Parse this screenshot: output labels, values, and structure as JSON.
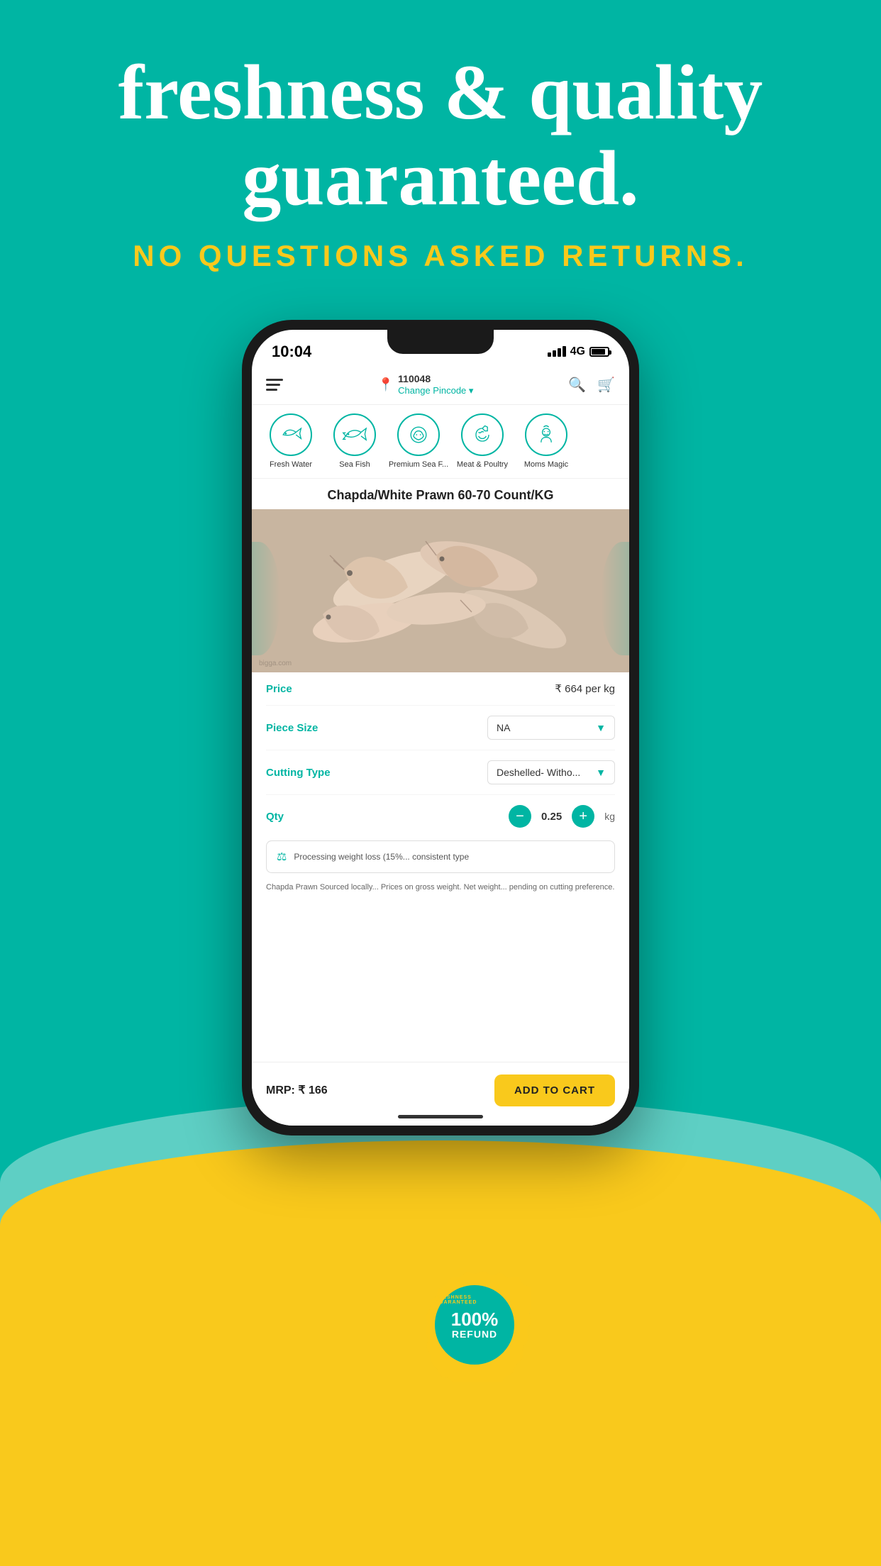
{
  "background": {
    "main_color": "#00B5A3",
    "wave_teal": "#5ECFC4",
    "wave_yellow": "#F9C91C"
  },
  "header": {
    "headline": "freshness  & quality guaranteed.",
    "subheadline": "NO QUESTIONS ASKED RETURNS."
  },
  "phone": {
    "status": {
      "time": "10:04",
      "network": "4G"
    },
    "app_header": {
      "pincode": "110048",
      "change_label": "Change Pincode",
      "dropdown_arrow": "▾"
    },
    "categories": [
      {
        "label": "Fresh Water",
        "icon": "fish"
      },
      {
        "label": "Sea Fish",
        "icon": "seafish"
      },
      {
        "label": "Premium Sea F...",
        "icon": "crab"
      },
      {
        "label": "Meat & Poultry",
        "icon": "octopus"
      },
      {
        "label": "Moms Magic",
        "icon": "chef"
      }
    ],
    "product": {
      "title": "Chapda/White Prawn 60-70 Count/KG",
      "price_label": "Price",
      "price_value": "₹ 664 per kg",
      "piece_size_label": "Piece Size",
      "piece_size_value": "NA",
      "cutting_type_label": "Cutting Type",
      "cutting_type_value": "Deshelled- Witho...",
      "qty_label": "Qty",
      "qty_value": "0.25",
      "qty_unit": "kg",
      "processing_text": "Processing weight loss (15%... consistent type",
      "description": "Chapda Prawn Sourced locally... Prices on gross weight. Net weight... pending on cutting preference.",
      "mrp_label": "MRP: ₹ 166",
      "add_to_cart": "ADD TO CART"
    },
    "stamp": {
      "top_text": "FRESHNESS GUARANT...",
      "percent": "100%",
      "refund": "REFUND"
    }
  }
}
